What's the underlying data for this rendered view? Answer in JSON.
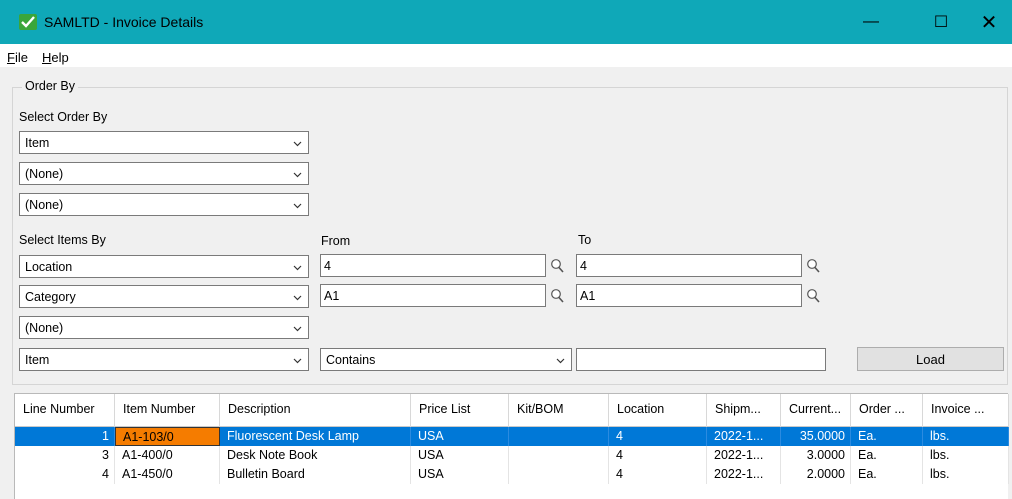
{
  "window": {
    "title": "SAMLTD - Invoice Details",
    "controls": {
      "minimize": "—",
      "maximize": "☐",
      "close": "✕"
    },
    "icon": "sage-check-icon"
  },
  "menu": [
    {
      "label": "File",
      "accel": "F",
      "rest": "ile"
    },
    {
      "label": "Help",
      "accel": "H",
      "rest": "elp"
    }
  ],
  "order_by": {
    "group_label": "Order By",
    "select_order_by_label": "Select Order By",
    "order_fields": [
      "Item",
      "(None)",
      "(None)"
    ],
    "select_items_by_label": "Select Items By",
    "from_label": "From",
    "to_label": "To",
    "criteria": [
      {
        "field": "Location",
        "from": "4",
        "to": "4"
      },
      {
        "field": "Category",
        "from": "A1",
        "to": "A1"
      },
      {
        "field": "(None)"
      }
    ],
    "filter": {
      "field": "Item",
      "operator": "Contains",
      "value": ""
    },
    "load_label": "Load"
  },
  "grid": {
    "columns": [
      "Line Number",
      "Item Number",
      "Description",
      "Price List",
      "Kit/BOM",
      "Location",
      "Shipm...",
      "Current...",
      "Order ...",
      "Invoice ..."
    ],
    "rows": [
      {
        "line": "1",
        "item": "A1-103/0",
        "description": "Fluorescent Desk Lamp",
        "price_list": "USA",
        "kit": "",
        "location": "4",
        "ship": "2022-1...",
        "current": "35.0000",
        "order_uom": "Ea.",
        "invoice_uom": "lbs."
      },
      {
        "line": "3",
        "item": "A1-400/0",
        "description": "Desk Note Book",
        "price_list": "USA",
        "kit": "",
        "location": "4",
        "ship": "2022-1...",
        "current": "3.0000",
        "order_uom": "Ea.",
        "invoice_uom": "lbs."
      },
      {
        "line": "4",
        "item": "A1-450/0",
        "description": "Bulletin Board",
        "price_list": "USA",
        "kit": "",
        "location": "4",
        "ship": "2022-1...",
        "current": "2.0000",
        "order_uom": "Ea.",
        "invoice_uom": "lbs."
      }
    ],
    "selected_row": 0,
    "colors": {
      "selection": "#0078d7",
      "focus_cell": "#f57c00"
    }
  },
  "theme": {
    "titlebar": "#0fa8b8",
    "client_bg": "#f0f0f0"
  }
}
